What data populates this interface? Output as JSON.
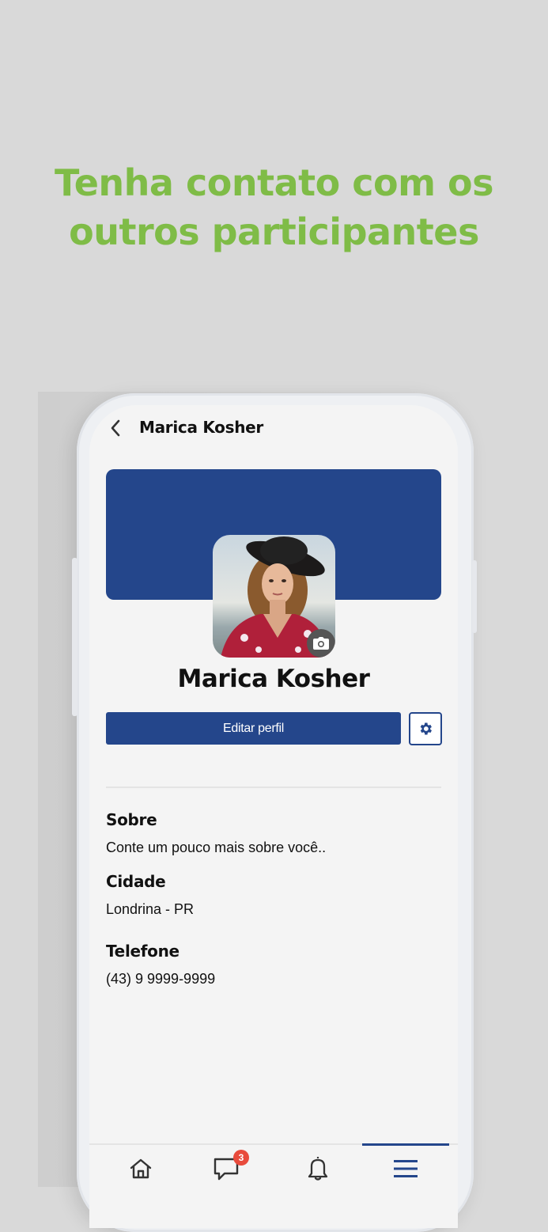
{
  "headline": {
    "line1": "Tenha contato com os",
    "line2": "outros participantes",
    "color": "#7fbc47"
  },
  "app": {
    "header": {
      "back_icon": "chevron-left-icon",
      "title": "Marica Kosher"
    },
    "profile": {
      "cover_color": "#24468b",
      "avatar_alt": "Marica Kosher",
      "camera_icon": "camera-icon",
      "name": "Marica Kosher",
      "edit_button_label": "Editar perfil",
      "settings_icon": "gear-icon"
    },
    "details": [
      {
        "label": "Sobre",
        "value": "Conte um pouco mais sobre você.."
      },
      {
        "label": "Cidade",
        "value": "Londrina - PR"
      },
      {
        "label": "Telefone",
        "value": "(43) 9 9999-9999"
      }
    ],
    "bottom_nav": {
      "items": [
        {
          "icon": "home-icon"
        },
        {
          "icon": "chat-icon",
          "badge": "3"
        },
        {
          "icon": "bell-icon"
        },
        {
          "icon": "menu-icon",
          "active": true
        }
      ],
      "badge_color": "#e84b3c"
    }
  }
}
